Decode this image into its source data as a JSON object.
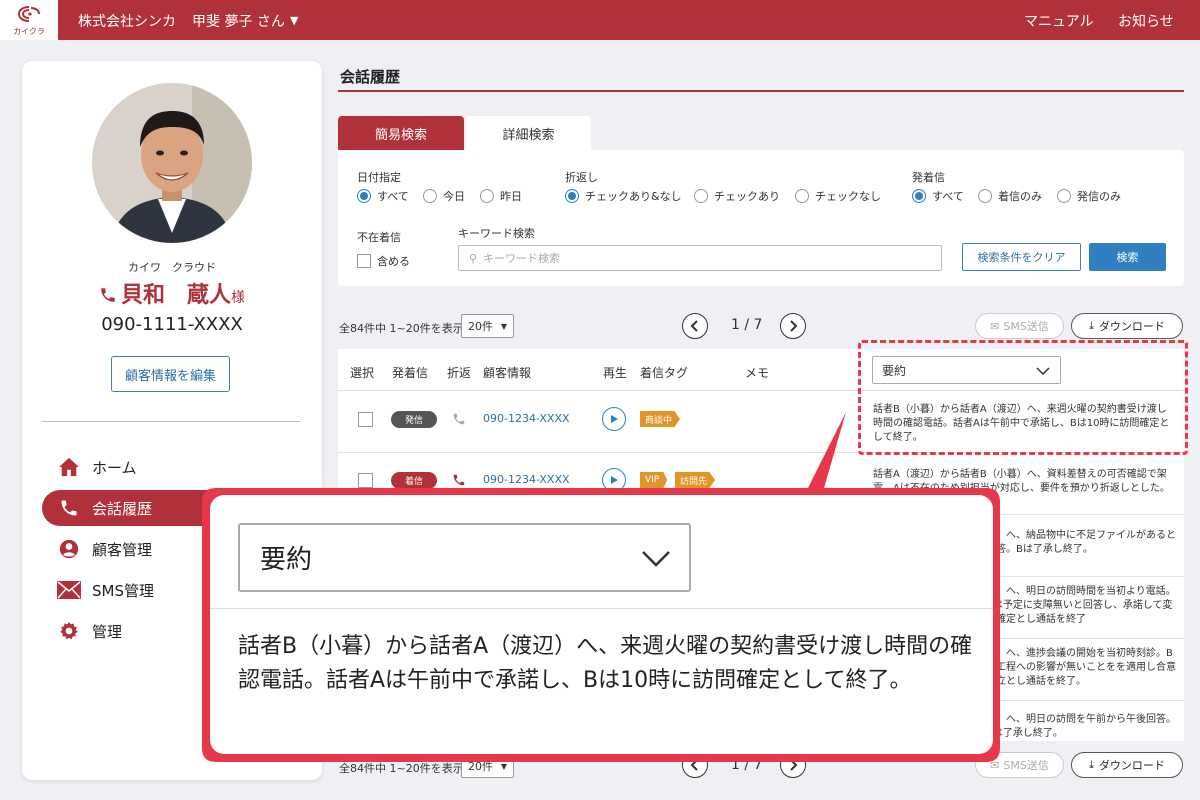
{
  "header": {
    "logo_text": "カイクラ",
    "company": "株式会社シンカ",
    "user": "甲斐 夢子 さん",
    "links": [
      "マニュアル",
      "お知らせ"
    ]
  },
  "customer": {
    "kana": "カイワ　クラウド",
    "name": "貝和　蔵人",
    "honorific": "様",
    "phone": "090-1111-XXXX",
    "edit_label": "顧客情報を編集"
  },
  "nav": {
    "items": [
      {
        "label": "ホーム",
        "icon": "home-icon"
      },
      {
        "label": "会話履歴",
        "icon": "phone-icon",
        "active": true
      },
      {
        "label": "顧客管理",
        "icon": "user-circle-icon"
      },
      {
        "label": "SMS管理",
        "icon": "mail-icon"
      },
      {
        "label": "管理",
        "icon": "gear-icon"
      }
    ]
  },
  "page": {
    "title": "会話履歴"
  },
  "tabs": [
    {
      "label": "簡易検索",
      "active": true
    },
    {
      "label": "詳細検索"
    }
  ],
  "search": {
    "date_label": "日付指定",
    "date_options": [
      "すべて",
      "今日",
      "昨日"
    ],
    "callback_label": "折返し",
    "callback_options": [
      "チェックあり&なし",
      "チェックあり",
      "チェックなし"
    ],
    "direction_label": "発着信",
    "direction_options": [
      "すべて",
      "着信のみ",
      "発信のみ"
    ],
    "missed_label": "不在着信",
    "missed_option": "含める",
    "keyword_label": "キーワード検索",
    "keyword_placeholder": "キーワード検索",
    "clear_label": "検索条件をクリア",
    "search_label": "検索"
  },
  "pagination": {
    "count_text": "全84件中 1~20件を表示",
    "per_page": "20件",
    "page_text": "1 / 7",
    "sms_label": "SMS送信",
    "download_label": "ダウンロード"
  },
  "table": {
    "headers": [
      "選択",
      "発着信",
      "折返",
      "顧客情報",
      "再生",
      "着信タグ",
      "メモ"
    ],
    "summary_select": "要約",
    "rows": [
      {
        "direction": "発信",
        "phone": "090-1234-XXXX",
        "tags": [
          "商談中"
        ],
        "summary": "話者B（小暮）から話者A（渡辺）へ、来週火曜の契約書受け渡し時間の確認電話。話者Aは午前中で承諾し、Bは10時に訪問確定として終了。"
      },
      {
        "direction": "着信",
        "phone": "090-1234-XXXX",
        "tags": [
          "VIP",
          "訪問先"
        ],
        "summary": "話者A（渡辺）から話者B（小暮）へ、資料差替えの可否確認で架電。Aは不在のため別担当が対応し、要件を預かり折返しとした。"
      },
      {
        "summary": "辺）へ、納品物中に不足ファイルがあると回答。Bは了承し終了。"
      },
      {
        "summary": "辺）へ、明日の訪問時間を当初より電話。Bは予定に支障無いと回答し、承諾して変更確定とし通話を終了"
      },
      {
        "summary": "暮）へ、進捗会議の開始を当初時刻診。Bは工程への影響が無いことをを適用し合意成立とし通話を終了。"
      },
      {
        "summary": "辺）へ、明日の訪問を午前から午後回答。Bは了承し終了。"
      }
    ]
  },
  "callout": {
    "select_label": "要約",
    "text": "話者B（小暮）から話者A（渡辺）へ、来週火曜の契約書受け渡し時間の確認電話。話者Aは午前中で承諾し、Bは10時に訪問確定として終了。"
  },
  "colors": {
    "brand": "#b0313a",
    "accent": "#2f7fc1",
    "tag": "#e0952a",
    "highlight": "#e8364a"
  }
}
